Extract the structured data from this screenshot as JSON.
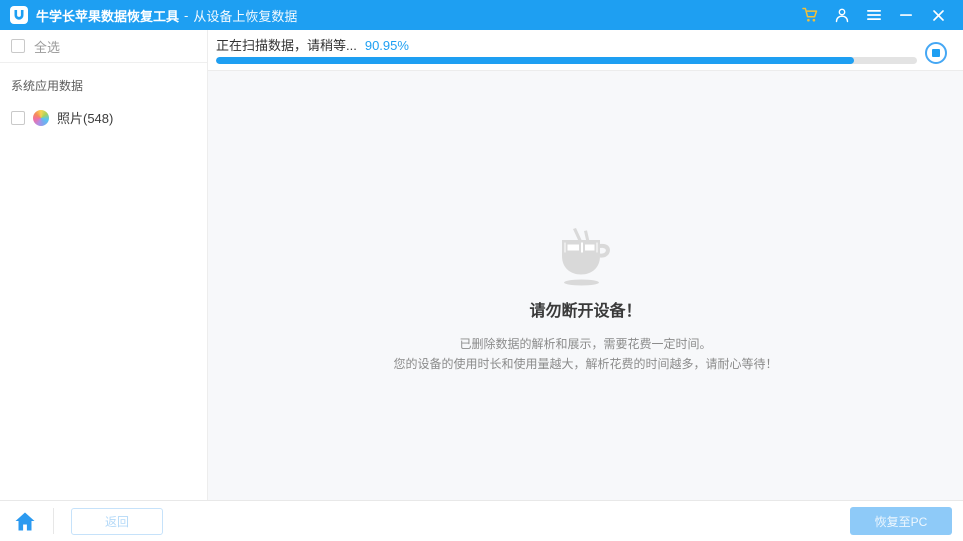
{
  "titlebar": {
    "app_title": "牛学长苹果数据恢复工具",
    "separator": "-",
    "subtitle": "从设备上恢复数据",
    "icons": {
      "logo": "ultdata-logo-icon",
      "cart": "cart-icon",
      "account": "user-icon",
      "menu": "hamburger-menu-icon",
      "minimize": "minimize-icon",
      "close": "close-icon"
    }
  },
  "sidebar": {
    "select_all_label": "全选",
    "select_all_checked": false,
    "section_label": "系统应用数据",
    "items": [
      {
        "label": "照片(548)",
        "checked": false,
        "icon": "photos-flower-icon"
      }
    ]
  },
  "progress": {
    "status_text": "正在扫描数据，请稍等...",
    "percent_label": "90.95%",
    "percent": 90.95,
    "stop_icon": "stop-icon"
  },
  "content": {
    "icon": "coffee-cup-icon",
    "heading": "请勿断开设备！",
    "line1": "已删除数据的解析和展示，需要花费一定时间。",
    "line2": "您的设备的使用时长和使用量越大，解析花费的时间越多，请耐心等待！"
  },
  "footer": {
    "home_icon": "home-icon",
    "back_label": "返回",
    "recover_label": "恢复至PC"
  },
  "colors": {
    "titlebar_blue": "#1e9ff2",
    "progress_blue": "#1e9ff2",
    "cart_gold": "#f2c037",
    "disabled_primary_bg": "#8ecaf8",
    "disabled_outline_border": "#c6e2fa"
  }
}
